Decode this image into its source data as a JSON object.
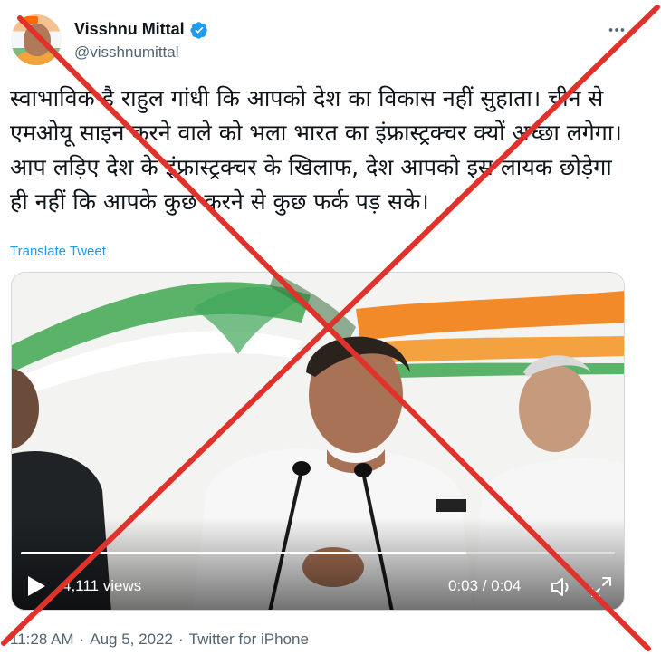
{
  "author": {
    "display_name": "Visshnu Mittal",
    "handle": "@visshnumittal",
    "verified": true
  },
  "tweet": {
    "text": "स्वाभाविक है राहुल गांधी कि आपको देश का विकास नहीं सुहाता। चीन से एमओयू साइन करने वाले को भला भारत का इंफ्रास्ट्रक्चर क्यों अच्छा लगेगा। आप लड़िए देश के इंफ्रास्ट्रक्चर के खिलाफ, देश आपको इस लायक छोड़ेगा ही नहीं कि आपके कुछ करने से कुछ फर्क पड़ सके।",
    "translate_label": "Translate Tweet"
  },
  "video": {
    "views": "4,111 views",
    "time": "0:03 / 0:04",
    "progress": 0.75
  },
  "footer": {
    "time": "11:28 AM",
    "separator": "·",
    "date": "Aug 5, 2022",
    "source": "Twitter for iPhone"
  },
  "icons": {
    "verified": "verified-badge-icon",
    "more": "more-options-icon",
    "play": "play-icon",
    "volume": "volume-icon",
    "fullscreen": "fullscreen-icon"
  },
  "colors": {
    "link": "#1d9bf0",
    "muted": "#536471",
    "overlay_x": "#e0322b"
  }
}
